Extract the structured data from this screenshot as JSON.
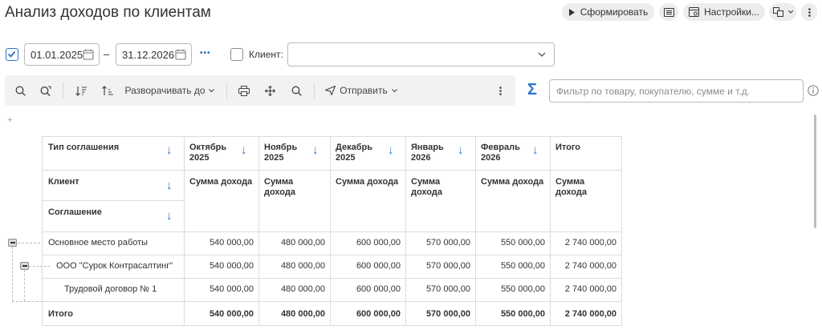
{
  "page": {
    "title": "Анализ доходов по клиентам"
  },
  "header": {
    "generate_label": "Сформировать",
    "settings_label": "Настройки..."
  },
  "filters": {
    "period_enabled": true,
    "date_from": "01.01.2025",
    "dash": "–",
    "date_to": "31.12.2026",
    "more": "•••",
    "client_enabled": false,
    "client_label": "Клиент:",
    "client_value": ""
  },
  "toolbar": {
    "expand_label": "Разворачивать до",
    "send_label": "Отправить",
    "sigma": "Σ",
    "filter_placeholder": "Фильтр по товару, покупателю, сумме и т.д."
  },
  "report": {
    "expand_all": "+",
    "row_headers": [
      "Тип соглашения",
      "Клиент",
      "Соглашение"
    ],
    "months": [
      {
        "line1": "Октябрь",
        "line2": "2025"
      },
      {
        "line1": "Ноябрь",
        "line2": "2025"
      },
      {
        "line1": "Декабрь",
        "line2": "2025"
      },
      {
        "line1": "Январь",
        "line2": "2026"
      },
      {
        "line1": "Февраль",
        "line2": "2026"
      }
    ],
    "total_header": "Итого",
    "measure": "Сумма дохода",
    "rows": [
      {
        "label": "Основное место работы",
        "values": [
          "540 000,00",
          "480 000,00",
          "600 000,00",
          "570 000,00",
          "550 000,00",
          "2 740 000,00"
        ]
      },
      {
        "label": "ООО \"Сурок Контрасалтинг\"",
        "values": [
          "540 000,00",
          "480 000,00",
          "600 000,00",
          "570 000,00",
          "550 000,00",
          "2 740 000,00"
        ]
      },
      {
        "label": "Трудовой договор № 1",
        "values": [
          "540 000,00",
          "480 000,00",
          "600 000,00",
          "570 000,00",
          "550 000,00",
          "2 740 000,00"
        ]
      }
    ],
    "total_row": {
      "label": "Итого",
      "values": [
        "540 000,00",
        "480 000,00",
        "600 000,00",
        "570 000,00",
        "550 000,00",
        "2 740 000,00"
      ]
    }
  },
  "colors": {
    "accent": "#2a74c9",
    "button_bg": "#ededed",
    "toolbar_bg": "#f2f2f2",
    "grid": "#dcdcdc"
  }
}
